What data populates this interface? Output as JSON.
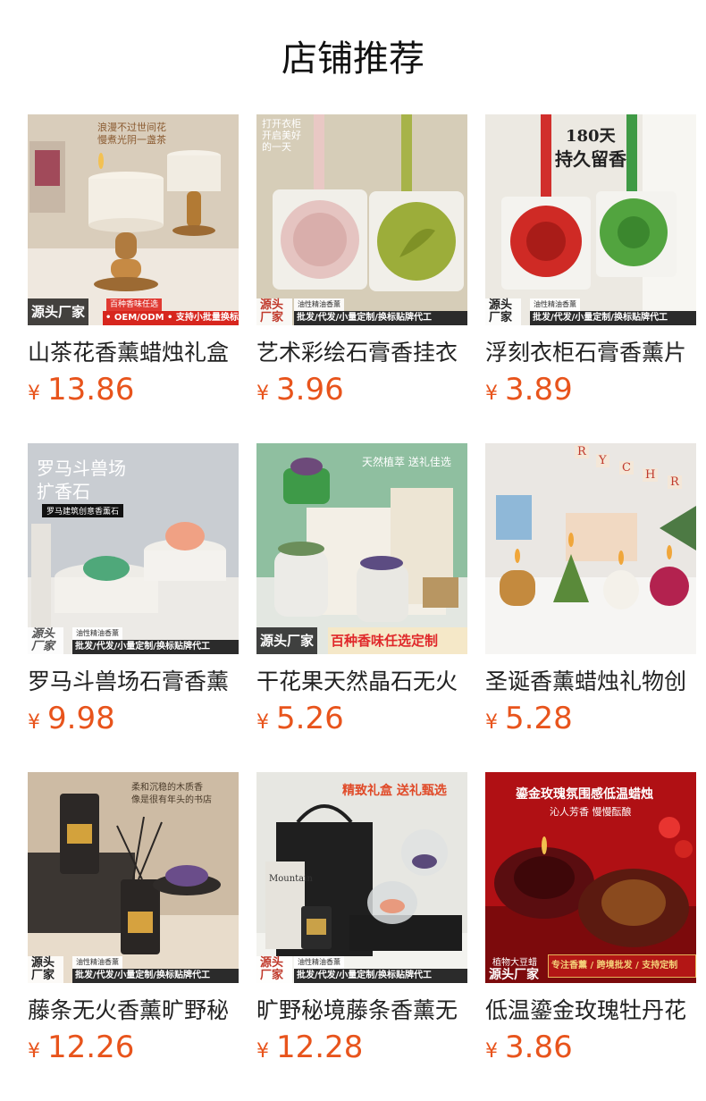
{
  "header": {
    "title": "店铺推荐"
  },
  "products": [
    {
      "name": "山茶花香薰蜡烛礼盒",
      "yen": "¥",
      "price": "13.86",
      "img_text": [
        "浪漫不过世间花",
        "慢煮光阴一盏茶"
      ],
      "brand": "源头厂家",
      "tag_top": "百种香味任选",
      "tag_bottom": "• OEM/ODM • 支持小批量换标",
      "icon": "candle-icon"
    },
    {
      "name": "艺术彩绘石膏香挂衣",
      "yen": "¥",
      "price": "3.96",
      "img_text": [
        "打开衣柜",
        "开启美好",
        "的一天"
      ],
      "brand": "源头厂家",
      "tag_top": "油性精油香薰",
      "tag_bottom": "批发/代发/小量定制/换标贴牌代工",
      "icon": "plaster-tag-icon"
    },
    {
      "name": "浮刻衣柜石膏香薰片",
      "yen": "¥",
      "price": "3.89",
      "img_text": [
        "180天",
        "持久留香"
      ],
      "brand": "源头厂家",
      "tag_top": "油性精油香薰",
      "tag_bottom": "批发/代发/小量定制/换标贴牌代工",
      "icon": "rose-plaque-icon"
    },
    {
      "name": "罗马斗兽场石膏香薰",
      "yen": "¥",
      "price": "9.98",
      "img_text": [
        "罗马斗兽场",
        "扩香石",
        "罗马建筑创意香薰石"
      ],
      "brand": "源头厂家",
      "tag_top": "油性精油香薰",
      "tag_bottom": "批发/代发/小量定制/换标贴牌代工",
      "icon": "colosseum-icon"
    },
    {
      "name": "干花果天然晶石无火",
      "yen": "¥",
      "price": "5.26",
      "img_text": [
        "天然植萃 送礼佳选"
      ],
      "brand": "源头厂家",
      "tag_top": "",
      "tag_bottom": "百种香味任选定制",
      "icon": "crystal-pot-icon"
    },
    {
      "name": "圣诞香薰蜡烛礼物创",
      "yen": "¥",
      "price": "5.28",
      "img_text": [
        "R",
        "Y",
        "C",
        "H",
        "R"
      ],
      "brand": "",
      "tag_top": "",
      "tag_bottom": "",
      "icon": "christmas-candle-icon"
    },
    {
      "name": "藤条无火香薰旷野秘",
      "yen": "¥",
      "price": "12.26",
      "img_text": [
        "柔和沉稳的木质香",
        "像是很有年头的书店"
      ],
      "brand": "源头厂家",
      "tag_top": "油性精油香薰",
      "tag_bottom": "批发/代发/小量定制/换标贴牌代工",
      "icon": "reed-diffuser-icon"
    },
    {
      "name": "旷野秘境藤条香薰无",
      "yen": "¥",
      "price": "12.28",
      "img_text": [
        "精致礼盒 送礼甄选",
        "Mountain"
      ],
      "brand": "源头厂家",
      "tag_top": "油性精油香薰",
      "tag_bottom": "批发/代发/小量定制/换标贴牌代工",
      "icon": "gift-box-icon"
    },
    {
      "name": "低温鎏金玫瑰牡丹花",
      "yen": "¥",
      "price": "3.86",
      "img_text": [
        "鎏金玫瑰氛围感低温蜡烛",
        "沁人芳香 慢慢酝酿",
        "植物大豆蜡"
      ],
      "brand": "源头厂家",
      "tag_top": "",
      "tag_bottom": "专注香薰 / 跨境批发 / 支持定制",
      "icon": "rose-candle-icon"
    }
  ],
  "colors": {
    "price": "#e8541c",
    "title": "#111111",
    "name": "#222222"
  }
}
